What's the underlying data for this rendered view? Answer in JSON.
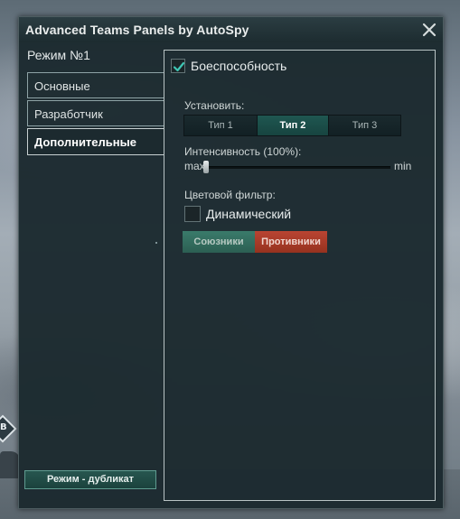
{
  "window": {
    "title": "Advanced Teams Panels by AutoSpy"
  },
  "sidebar": {
    "mode_title": "Режим №1",
    "tabs": [
      {
        "label": "Основные",
        "active": false
      },
      {
        "label": "Разработчик",
        "active": false
      },
      {
        "label": "Дополнительные",
        "active": true
      }
    ],
    "duplicate_button": "Режим - дубликат"
  },
  "panel": {
    "combat_checkbox": {
      "label": "Боеспособность",
      "checked": true
    },
    "install_label": "Установить:",
    "types": [
      {
        "label": "Тип 1",
        "selected": false
      },
      {
        "label": "Тип 2",
        "selected": true
      },
      {
        "label": "Тип 3",
        "selected": false
      }
    ],
    "intensity_label": "Интенсивность (100%):",
    "slider": {
      "max_label": "max",
      "min_label": "min",
      "value_percent": 100
    },
    "filter_label": "Цветовой фильтр:",
    "dynamic_checkbox": {
      "label": "Динамический",
      "checked": false
    },
    "allies_button": "Союзники",
    "enemies_button": "Противники"
  },
  "colors": {
    "allies": "#2f6b5d",
    "enemies": "#a8392a",
    "selected_tab": "#1f5751"
  },
  "map_marker_label": "B"
}
